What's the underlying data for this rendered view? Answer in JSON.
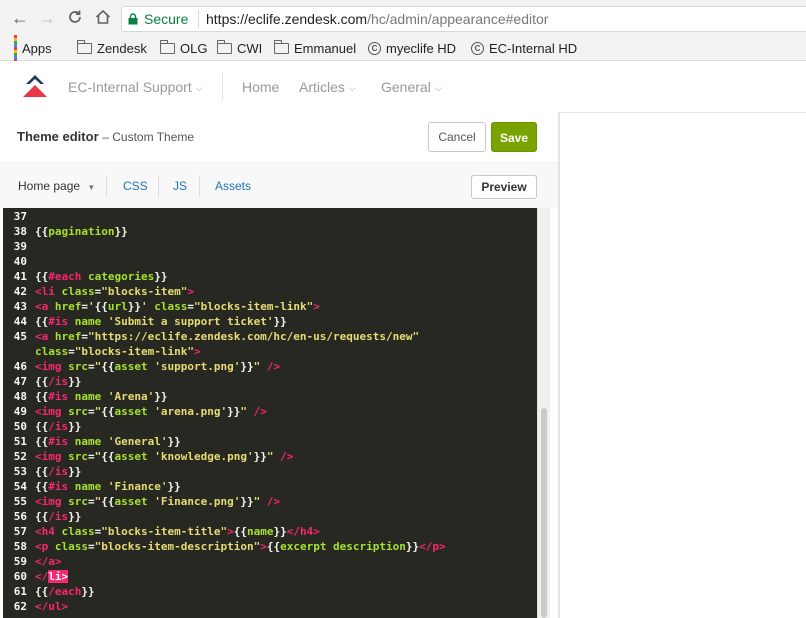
{
  "browser": {
    "security_label": "Secure",
    "url_base": "https://eclife.zendesk.com",
    "url_path": "/hc/admin/appearance#editor",
    "bookmarks": [
      {
        "label": "Apps",
        "icon": "apps-grid-icon"
      },
      {
        "label": "Zendesk",
        "icon": "folder-icon"
      },
      {
        "label": "OLG",
        "icon": "folder-icon"
      },
      {
        "label": "CWI",
        "icon": "folder-icon"
      },
      {
        "label": "Emmanuel",
        "icon": "folder-icon"
      },
      {
        "label": "myeclife HD",
        "icon": "copyright-icon"
      },
      {
        "label": "EC-Internal HD",
        "icon": "copyright-icon"
      }
    ]
  },
  "site_header": {
    "brand": "EC-Internal Support",
    "nav": [
      "Home",
      "Articles",
      "General"
    ]
  },
  "editor": {
    "title": "Theme editor",
    "subtitle": "– Custom Theme",
    "cancel_label": "Cancel",
    "save_label": "Save",
    "page_select": "Home page",
    "tabs": [
      "CSS",
      "JS",
      "Assets"
    ],
    "preview_label": "Preview"
  },
  "colors": {
    "save_green": "#78a300",
    "link_blue": "#1f73b7",
    "editor_bg": "#272822",
    "secure_green": "#0b8043"
  },
  "code_lines": [
    {
      "n": "37",
      "segs": []
    },
    {
      "n": "38",
      "segs": [
        [
          "br",
          "{{"
        ],
        [
          "kw",
          "pagination"
        ],
        [
          "br",
          "}}"
        ]
      ]
    },
    {
      "n": "39",
      "segs": []
    },
    {
      "n": "40",
      "segs": []
    },
    {
      "n": "41",
      "segs": [
        [
          "br",
          "{{"
        ],
        [
          "sp",
          "#each"
        ],
        [
          "br",
          " "
        ],
        [
          "kw",
          "categories"
        ],
        [
          "br",
          "}}"
        ]
      ]
    },
    {
      "n": "42",
      "segs": [
        [
          "tg",
          "<li "
        ],
        [
          "at",
          "class"
        ],
        [
          "txt",
          "="
        ],
        [
          "s",
          "\"blocks-item\""
        ],
        [
          "tg",
          ">"
        ]
      ]
    },
    {
      "n": "43",
      "segs": [
        [
          "tg",
          "<a "
        ],
        [
          "at",
          "href"
        ],
        [
          "txt",
          "="
        ],
        [
          "s",
          "'"
        ],
        [
          "br",
          "{{"
        ],
        [
          "kw",
          "url"
        ],
        [
          "br",
          "}}"
        ],
        [
          "s",
          "'"
        ],
        [
          "txt",
          " "
        ],
        [
          "at",
          "class"
        ],
        [
          "txt",
          "="
        ],
        [
          "s",
          "\"blocks-item-link\""
        ],
        [
          "tg",
          ">"
        ]
      ]
    },
    {
      "n": "44",
      "segs": [
        [
          "br",
          "{{"
        ],
        [
          "sp",
          "#is"
        ],
        [
          "br",
          " "
        ],
        [
          "kw",
          "name"
        ],
        [
          "br",
          " "
        ],
        [
          "s",
          "'Submit a support ticket'"
        ],
        [
          "br",
          "}}"
        ]
      ]
    },
    {
      "n": "45",
      "segs": [
        [
          "tg",
          "<a "
        ],
        [
          "at",
          "href"
        ],
        [
          "txt",
          "="
        ],
        [
          "s",
          "\"https://eclife.zendesk.com/hc/en-us/requests/new\""
        ]
      ]
    },
    {
      "n": "",
      "segs": [
        [
          "at",
          "class"
        ],
        [
          "txt",
          "="
        ],
        [
          "s",
          "\"blocks-item-link\""
        ],
        [
          "tg",
          ">"
        ]
      ]
    },
    {
      "n": "46",
      "segs": [
        [
          "tg",
          "<img "
        ],
        [
          "at",
          "src"
        ],
        [
          "txt",
          "="
        ],
        [
          "s",
          "\""
        ],
        [
          "br",
          "{{"
        ],
        [
          "kw",
          "asset"
        ],
        [
          "br",
          " "
        ],
        [
          "s",
          "'support.png'"
        ],
        [
          "br",
          "}}"
        ],
        [
          "s",
          "\""
        ],
        [
          "tg",
          " />"
        ]
      ]
    },
    {
      "n": "47",
      "segs": [
        [
          "br",
          "{{"
        ],
        [
          "sp",
          "/is"
        ],
        [
          "br",
          "}}"
        ]
      ]
    },
    {
      "n": "48",
      "segs": [
        [
          "br",
          "{{"
        ],
        [
          "sp",
          "#is"
        ],
        [
          "br",
          " "
        ],
        [
          "kw",
          "name"
        ],
        [
          "br",
          " "
        ],
        [
          "s",
          "'Arena'"
        ],
        [
          "br",
          "}}"
        ]
      ]
    },
    {
      "n": "49",
      "segs": [
        [
          "tg",
          "<img "
        ],
        [
          "at",
          "src"
        ],
        [
          "txt",
          "="
        ],
        [
          "s",
          "\""
        ],
        [
          "br",
          "{{"
        ],
        [
          "kw",
          "asset"
        ],
        [
          "br",
          " "
        ],
        [
          "s",
          "'arena.png'"
        ],
        [
          "br",
          "}}"
        ],
        [
          "s",
          "\""
        ],
        [
          "tg",
          " />"
        ]
      ]
    },
    {
      "n": "50",
      "segs": [
        [
          "br",
          "{{"
        ],
        [
          "sp",
          "/is"
        ],
        [
          "br",
          "}}"
        ]
      ]
    },
    {
      "n": "51",
      "segs": [
        [
          "br",
          "{{"
        ],
        [
          "sp",
          "#is"
        ],
        [
          "br",
          " "
        ],
        [
          "kw",
          "name"
        ],
        [
          "br",
          " "
        ],
        [
          "s",
          "'General'"
        ],
        [
          "br",
          "}}"
        ]
      ]
    },
    {
      "n": "52",
      "segs": [
        [
          "tg",
          "<img "
        ],
        [
          "at",
          "src"
        ],
        [
          "txt",
          "="
        ],
        [
          "s",
          "\""
        ],
        [
          "br",
          "{{"
        ],
        [
          "kw",
          "asset"
        ],
        [
          "br",
          " "
        ],
        [
          "s",
          "'knowledge.png'"
        ],
        [
          "br",
          "}}"
        ],
        [
          "s",
          "\""
        ],
        [
          "tg",
          " />"
        ]
      ]
    },
    {
      "n": "53",
      "segs": [
        [
          "br",
          "{{"
        ],
        [
          "sp",
          "/is"
        ],
        [
          "br",
          "}}"
        ]
      ]
    },
    {
      "n": "54",
      "segs": [
        [
          "br",
          "{{"
        ],
        [
          "sp",
          "#is"
        ],
        [
          "br",
          " "
        ],
        [
          "kw",
          "name"
        ],
        [
          "br",
          " "
        ],
        [
          "s",
          "'Finance'"
        ],
        [
          "br",
          "}}"
        ]
      ]
    },
    {
      "n": "55",
      "segs": [
        [
          "tg",
          "<img "
        ],
        [
          "at",
          "src"
        ],
        [
          "txt",
          "="
        ],
        [
          "s",
          "\""
        ],
        [
          "br",
          "{{"
        ],
        [
          "kw",
          "asset"
        ],
        [
          "br",
          " "
        ],
        [
          "s",
          "'Finance.png'"
        ],
        [
          "br",
          "}}"
        ],
        [
          "s",
          "\""
        ],
        [
          "tg",
          " />"
        ]
      ]
    },
    {
      "n": "56",
      "segs": [
        [
          "br",
          "{{"
        ],
        [
          "sp",
          "/is"
        ],
        [
          "br",
          "}}"
        ]
      ]
    },
    {
      "n": "57",
      "segs": [
        [
          "tg",
          "<h4 "
        ],
        [
          "at",
          "class"
        ],
        [
          "txt",
          "="
        ],
        [
          "s",
          "\"blocks-item-title\""
        ],
        [
          "tg",
          ">"
        ],
        [
          "br",
          "{{"
        ],
        [
          "kw",
          "name"
        ],
        [
          "br",
          "}}"
        ],
        [
          "tg",
          "</h4>"
        ]
      ]
    },
    {
      "n": "58",
      "segs": [
        [
          "tg",
          "<p "
        ],
        [
          "at",
          "class"
        ],
        [
          "txt",
          "="
        ],
        [
          "s",
          "\"blocks-item-description\""
        ],
        [
          "tg",
          ">"
        ],
        [
          "br",
          "{{"
        ],
        [
          "kw",
          "excerpt description"
        ],
        [
          "br",
          "}}"
        ],
        [
          "tg",
          "</p>"
        ]
      ]
    },
    {
      "n": "59",
      "segs": [
        [
          "tg",
          "</a>"
        ]
      ]
    },
    {
      "n": "60",
      "segs": [
        [
          "tg",
          "</"
        ],
        [
          "hl",
          "li>"
        ]
      ]
    },
    {
      "n": "61",
      "segs": [
        [
          "br",
          "{{"
        ],
        [
          "sp",
          "/each"
        ],
        [
          "br",
          "}}"
        ]
      ]
    },
    {
      "n": "62",
      "segs": [
        [
          "tg",
          "</ul>"
        ]
      ]
    }
  ]
}
